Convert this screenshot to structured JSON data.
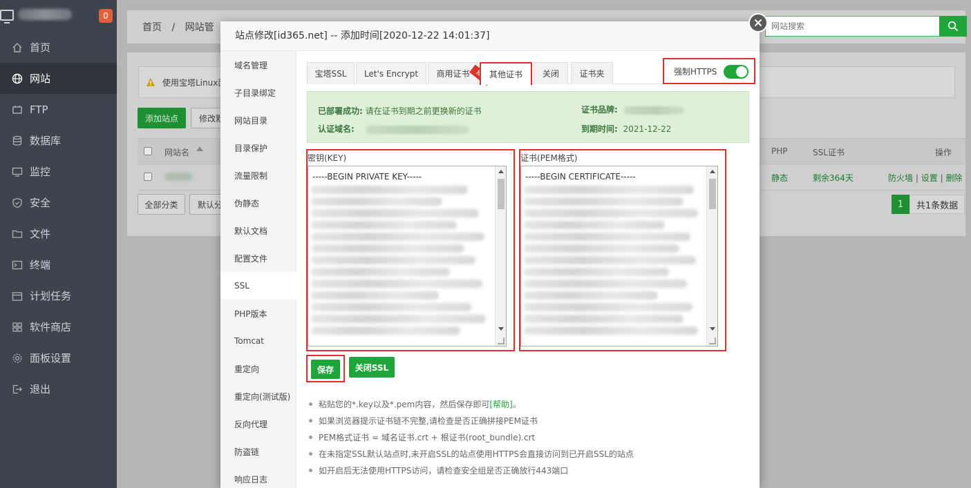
{
  "sidebar": {
    "badge": "0",
    "items": [
      {
        "label": "首页",
        "icon": "home-icon"
      },
      {
        "label": "网站",
        "icon": "globe-icon"
      },
      {
        "label": "FTP",
        "icon": "ftp-icon"
      },
      {
        "label": "数据库",
        "icon": "database-icon"
      },
      {
        "label": "监控",
        "icon": "monitor-icon"
      },
      {
        "label": "安全",
        "icon": "shield-icon"
      },
      {
        "label": "文件",
        "icon": "folder-icon"
      },
      {
        "label": "终端",
        "icon": "terminal-icon"
      },
      {
        "label": "计划任务",
        "icon": "calendar-icon"
      },
      {
        "label": "软件商店",
        "icon": "grid-icon"
      },
      {
        "label": "面板设置",
        "icon": "gear-icon"
      },
      {
        "label": "退出",
        "icon": "logout-icon"
      }
    ]
  },
  "breadcrumb": {
    "home": "首页",
    "sep": "/",
    "current": "网站管"
  },
  "search": {
    "placeholder": "网站搜索"
  },
  "background": {
    "notice": "使用宝塔Linux面",
    "add_site": "添加站点",
    "modify": "修改默",
    "all_category": "全部分类",
    "default_category": "默认分",
    "columns": {
      "site_name": "网站名",
      "php": "PHP",
      "ssl": "SSL证书",
      "action": "操作"
    },
    "row": {
      "php": "静态",
      "ssl": "剩余364天",
      "firewall": "防火墙",
      "sep1": "|",
      "settings": "设置",
      "sep2": "|",
      "delete": "删除"
    },
    "page": "1",
    "total": "共1条数据"
  },
  "modal": {
    "title": "站点修改[id365.net] -- 添加时间[2020-12-22 14:01:37]",
    "nav": [
      "域名管理",
      "子目录绑定",
      "网站目录",
      "目录保护",
      "流量限制",
      "伪静态",
      "默认文档",
      "配置文件",
      "SSL",
      "PHP版本",
      "Tomcat",
      "重定向",
      "重定向(测试版)",
      "反向代理",
      "防盗链",
      "响应日志"
    ],
    "tabs": [
      "宝塔SSL",
      "Let's Encrypt",
      "商用证书",
      "其他证书",
      "关闭",
      "证书夹"
    ],
    "ribbon": "推荐",
    "force_https": "强制HTTPS",
    "status": {
      "deployed_label": "已部署成功:",
      "deployed_value": "请在证书到期之前更换新的证书",
      "domain_label": "认证域名:",
      "brand_label": "证书品牌:",
      "expire_label": "到期时间:",
      "expire_value": "2021-12-22"
    },
    "key_label": "密钥(KEY)",
    "key_first_line": "-----BEGIN PRIVATE KEY-----",
    "pem_label": "证书(PEM格式)",
    "pem_first_line": "-----BEGIN CERTIFICATE-----",
    "save": "保存",
    "close_ssl": "关闭SSL",
    "tips": [
      {
        "text": "粘贴您的*.key以及*.pem内容，然后保存即可",
        "link": "[帮助]",
        "tail": "。"
      },
      {
        "text": "如果浏览器提示证书链不完整,请检查是否正确拼接PEM证书"
      },
      {
        "text": "PEM格式证书 = 域名证书.crt + 根证书(root_bundle).crt"
      },
      {
        "text": "在未指定SSL默认站点时,未开启SSL的站点使用HTTPS会直接访问到已开启SSL的站点"
      },
      {
        "text": "如开启后无法使用HTTPS访问，请检查安全组是否正确放行443端口"
      }
    ]
  },
  "colors": {
    "accent": "#20a53a",
    "highlight": "#e02d2d",
    "sidebar": "#3c444d"
  }
}
